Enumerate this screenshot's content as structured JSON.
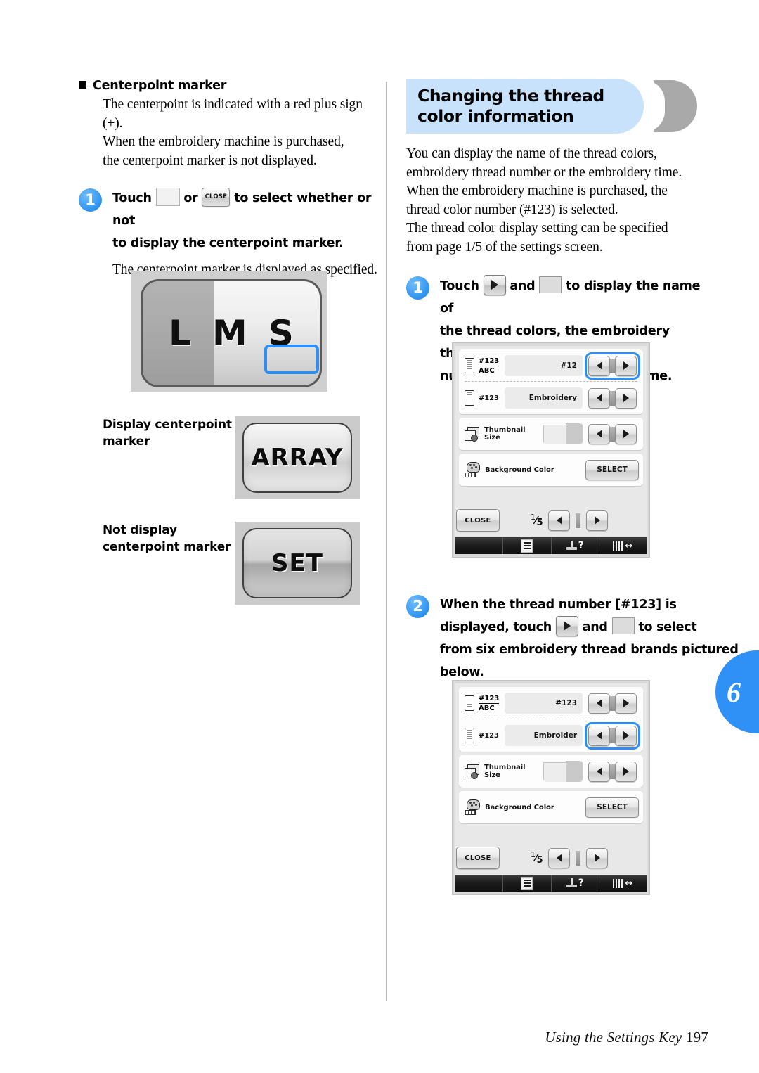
{
  "left": {
    "section_heading": "Centerpoint marker",
    "intro_lines": [
      "The centerpoint is indicated with a red plus sign",
      "(+).",
      "When the embroidery machine is purchased,",
      "the centerpoint marker is not displayed."
    ],
    "step1": {
      "number": "1",
      "text_a": "Touch",
      "text_b": "or",
      "close_key_label": "CLOSE",
      "text_c": "to select whether or not",
      "text_d": "to display the centerpoint marker.",
      "sub": "The centerpoint marker is displayed as specified."
    },
    "lms_figure": {
      "letters": [
        "L",
        "M",
        "S"
      ]
    },
    "captions": [
      {
        "label": "Display centerpoint marker",
        "key_label": "ARRAY"
      },
      {
        "label": "Not display centerpoint marker",
        "key_label": "SET"
      }
    ]
  },
  "right": {
    "banner_title": "Changing the thread color information",
    "intro_lines": [
      "You can display the name of the thread colors,",
      "embroidery thread number or the embroidery time.",
      "When the embroidery machine is purchased, the",
      "thread color number (#123) is selected.",
      "The thread color display setting can be specified",
      "from page 1/5 of the settings screen."
    ],
    "step1": {
      "number": "1",
      "text_a": "Touch",
      "text_b": "and",
      "text_c": "to display the name of",
      "line2": "the thread colors, the embroidery thread",
      "line3": "number or the embroidering time."
    },
    "step2": {
      "number": "2",
      "line1": "When the thread number [#123] is",
      "text_a": "displayed, touch",
      "text_b": "and",
      "text_c": "to select",
      "line3": "from six embroidery thread brands pictured",
      "line4": "below."
    }
  },
  "lcd_screen_1": {
    "rows": [
      {
        "icon": "thread-spool-icon",
        "label_top": "#123",
        "label_bottom": "ABC",
        "value": "#12",
        "control": "arrow-pair",
        "highlighted": true
      },
      {
        "icon": "thread-spool-icon",
        "label_top": "#123",
        "value": "Embroidery",
        "control": "arrow-pair",
        "highlighted": false
      },
      {
        "icon": "thumbnail-size-icon",
        "label": "Thumbnail Size",
        "value": "",
        "control": "arrow-pair",
        "highlighted": false
      },
      {
        "icon": "background-color-icon",
        "label": "Background Color",
        "value": "",
        "control": "select-button",
        "button_label": "SELECT",
        "highlighted": false
      }
    ],
    "close_label": "CLOSE",
    "page_indicator": {
      "current": "1",
      "total": "5"
    },
    "taskbar_icons": [
      "settings-list-icon",
      "presser-foot-help-icon",
      "stitch-width-icon"
    ]
  },
  "lcd_screen_2": {
    "rows": [
      {
        "icon": "thread-spool-icon",
        "label_top": "#123",
        "label_bottom": "ABC",
        "value": "#123",
        "control": "arrow-pair",
        "highlighted": false
      },
      {
        "icon": "thread-spool-icon",
        "label_top": "#123",
        "value": "Embroider",
        "control": "arrow-pair",
        "highlighted": true
      },
      {
        "icon": "thumbnail-size-icon",
        "label": "Thumbnail Size",
        "value": "",
        "control": "arrow-pair",
        "highlighted": false
      },
      {
        "icon": "background-color-icon",
        "label": "Background Color",
        "value": "",
        "control": "select-button",
        "button_label": "SELECT",
        "highlighted": false
      }
    ],
    "close_label": "CLOSE",
    "page_indicator": {
      "current": "1",
      "total": "5"
    },
    "taskbar_icons": [
      "settings-list-icon",
      "presser-foot-help-icon",
      "stitch-width-icon"
    ]
  },
  "chapter_tab": {
    "number": "6"
  },
  "footer": {
    "title": "Using the Settings Key",
    "page": "197"
  },
  "colors": {
    "banner_bg": "#c7e2fa",
    "banner_tail": "#a9a9a9",
    "accent_blue": "#2f90f5",
    "highlight_blue": "#2f8ef2"
  }
}
